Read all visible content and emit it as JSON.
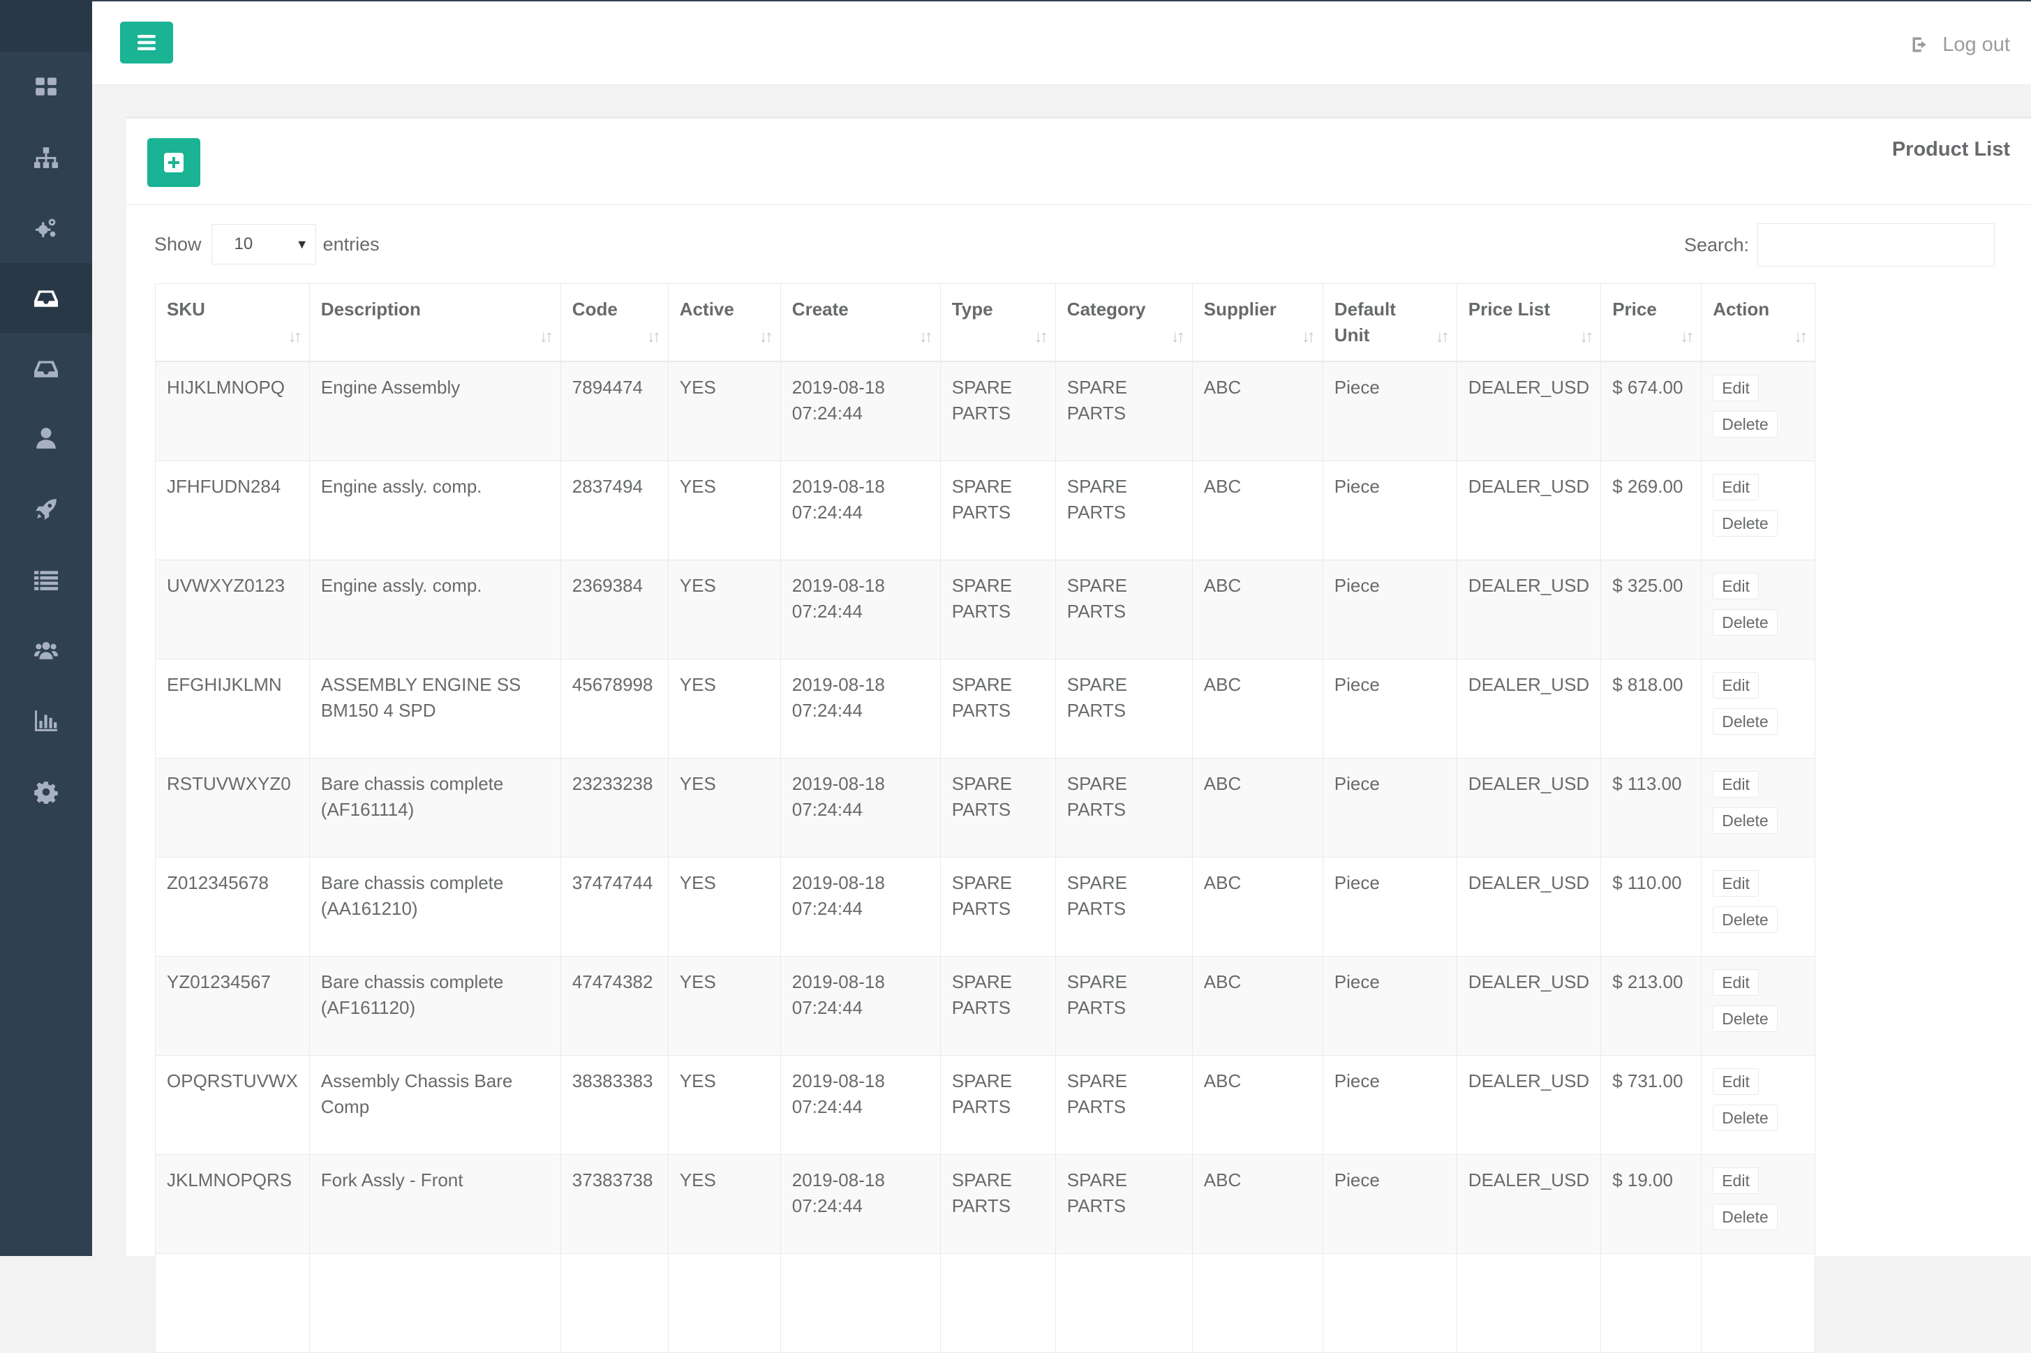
{
  "header": {
    "logout_label": "Log out"
  },
  "sidebar": {
    "items": [
      {
        "icon": "dashboard-icon"
      },
      {
        "icon": "sitemap-icon"
      },
      {
        "icon": "cogs-icon"
      },
      {
        "icon": "inbox-icon",
        "active": true
      },
      {
        "icon": "inbox-outline-icon"
      },
      {
        "icon": "user-icon"
      },
      {
        "icon": "rocket-icon"
      },
      {
        "icon": "list-icon"
      },
      {
        "icon": "users-icon"
      },
      {
        "icon": "bar-chart-icon"
      },
      {
        "icon": "gear-icon"
      }
    ]
  },
  "panel": {
    "title": "Product List"
  },
  "controls": {
    "show_label": "Show",
    "entries_value": "10",
    "entries_label": "entries",
    "search_label": "Search:",
    "search_value": ""
  },
  "table": {
    "columns": [
      "SKU",
      "Description",
      "Code",
      "Active",
      "Create",
      "Type",
      "Category",
      "Supplier",
      "Default Unit",
      "Price List",
      "Price",
      "Action"
    ],
    "edit_label": "Edit",
    "delete_label": "Delete",
    "rows": [
      {
        "sku": "HIJKLMNOPQ",
        "description": "Engine Assembly",
        "code": "7894474",
        "active": "YES",
        "create": "2019-08-18 07:24:44",
        "type": "SPARE PARTS",
        "category": "SPARE PARTS",
        "supplier": "ABC",
        "unit": "Piece",
        "price_list": "DEALER_USD",
        "price": "$ 674.00"
      },
      {
        "sku": "JFHFUDN284",
        "description": "Engine assly. comp.",
        "code": "2837494",
        "active": "YES",
        "create": "2019-08-18 07:24:44",
        "type": "SPARE PARTS",
        "category": "SPARE PARTS",
        "supplier": "ABC",
        "unit": "Piece",
        "price_list": "DEALER_USD",
        "price": "$ 269.00"
      },
      {
        "sku": "UVWXYZ0123",
        "description": "Engine assly. comp.",
        "code": "2369384",
        "active": "YES",
        "create": "2019-08-18 07:24:44",
        "type": "SPARE PARTS",
        "category": "SPARE PARTS",
        "supplier": "ABC",
        "unit": "Piece",
        "price_list": "DEALER_USD",
        "price": "$ 325.00"
      },
      {
        "sku": "EFGHIJKLMN",
        "description": "ASSEMBLY ENGINE SS BM150 4 SPD",
        "code": "45678998",
        "active": "YES",
        "create": "2019-08-18 07:24:44",
        "type": "SPARE PARTS",
        "category": "SPARE PARTS",
        "supplier": "ABC",
        "unit": "Piece",
        "price_list": "DEALER_USD",
        "price": "$ 818.00"
      },
      {
        "sku": "RSTUVWXYZ0",
        "description": "Bare chassis complete (AF161114)",
        "code": "23233238",
        "active": "YES",
        "create": "2019-08-18 07:24:44",
        "type": "SPARE PARTS",
        "category": "SPARE PARTS",
        "supplier": "ABC",
        "unit": "Piece",
        "price_list": "DEALER_USD",
        "price": "$ 113.00"
      },
      {
        "sku": "Z012345678",
        "description": "Bare chassis complete (AA161210)",
        "code": "37474744",
        "active": "YES",
        "create": "2019-08-18 07:24:44",
        "type": "SPARE PARTS",
        "category": "SPARE PARTS",
        "supplier": "ABC",
        "unit": "Piece",
        "price_list": "DEALER_USD",
        "price": "$ 110.00"
      },
      {
        "sku": "YZ01234567",
        "description": "Bare chassis complete (AF161120)",
        "code": "47474382",
        "active": "YES",
        "create": "2019-08-18 07:24:44",
        "type": "SPARE PARTS",
        "category": "SPARE PARTS",
        "supplier": "ABC",
        "unit": "Piece",
        "price_list": "DEALER_USD",
        "price": "$ 213.00"
      },
      {
        "sku": "OPQRSTUVWX",
        "description": "Assembly Chassis Bare Comp",
        "code": "38383383",
        "active": "YES",
        "create": "2019-08-18 07:24:44",
        "type": "SPARE PARTS",
        "category": "SPARE PARTS",
        "supplier": "ABC",
        "unit": "Piece",
        "price_list": "DEALER_USD",
        "price": "$ 731.00"
      },
      {
        "sku": "JKLMNOPQRS",
        "description": "Fork Assly - Front",
        "code": "37383738",
        "active": "YES",
        "create": "2019-08-18 07:24:44",
        "type": "SPARE PARTS",
        "category": "SPARE PARTS",
        "supplier": "ABC",
        "unit": "Piece",
        "price_list": "DEALER_USD",
        "price": "$ 19.00"
      },
      {
        "sku": "",
        "description": "",
        "code": "",
        "active": "",
        "create": "",
        "type": "",
        "category": "",
        "supplier": "",
        "unit": "",
        "price_list": "",
        "price": ""
      }
    ]
  }
}
